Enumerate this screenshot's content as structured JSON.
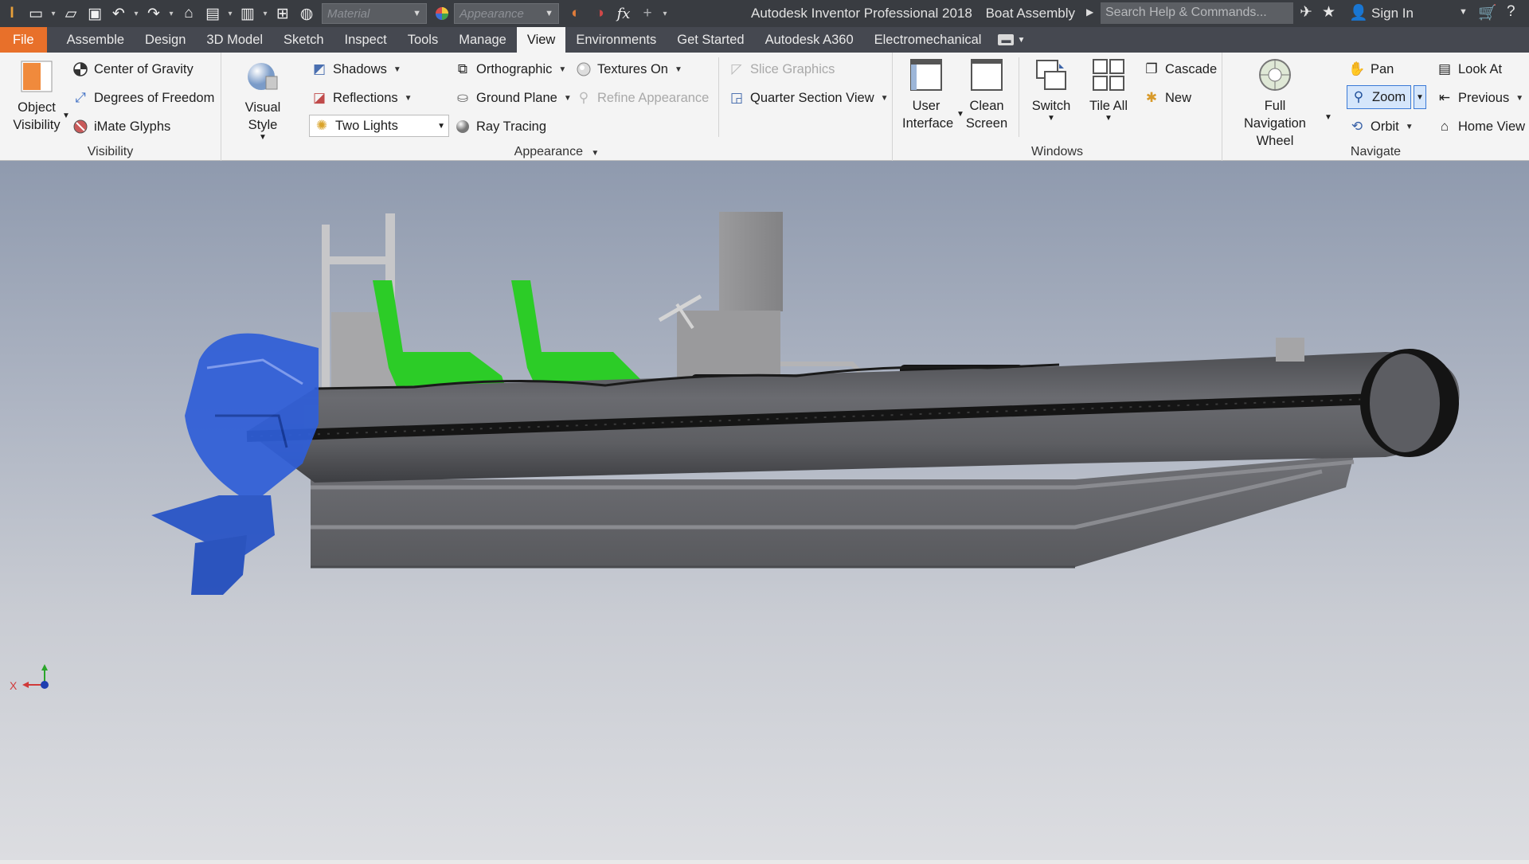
{
  "app_title": "Autodesk Inventor Professional 2018",
  "document_title": "Boat Assembly",
  "quick_access": {
    "material_placeholder": "Material",
    "appearance_placeholder": "Appearance",
    "fx_label": "fx"
  },
  "search": {
    "placeholder": "Search Help & Commands..."
  },
  "sign_in": "Sign In",
  "tabs": [
    "File",
    "Assemble",
    "Design",
    "3D Model",
    "Sketch",
    "Inspect",
    "Tools",
    "Manage",
    "View",
    "Environments",
    "Get Started",
    "Autodesk A360",
    "Electromechanical"
  ],
  "active_tab": "View",
  "panels": {
    "visibility": {
      "title": "Visibility",
      "object_visibility": "Object Visibility",
      "center_of_gravity": "Center of Gravity",
      "degrees_of_freedom": "Degrees of Freedom",
      "imate_glyphs": "iMate Glyphs"
    },
    "appearance": {
      "title": "Appearance",
      "visual_style": "Visual Style",
      "shadows": "Shadows",
      "reflections": "Reflections",
      "lighting_value": "Two Lights",
      "orthographic": "Orthographic",
      "ground_plane": "Ground Plane",
      "ray_tracing": "Ray Tracing",
      "textures_on": "Textures On",
      "refine_appearance": "Refine Appearance",
      "slice_graphics": "Slice Graphics",
      "quarter_section_view": "Quarter Section View"
    },
    "windows": {
      "title": "Windows",
      "user_interface": "User Interface",
      "clean_screen": "Clean Screen",
      "switch": "Switch",
      "tile_all": "Tile All",
      "cascade": "Cascade",
      "new": "New"
    },
    "navigate": {
      "title": "Navigate",
      "full_navigation_wheel": "Full Navigation Wheel",
      "pan": "Pan",
      "zoom": "Zoom",
      "orbit": "Orbit",
      "look_at": "Look At",
      "previous": "Previous",
      "home_view": "Home View"
    }
  },
  "viewport": {
    "axis_x_label": "X",
    "model_colors": {
      "tube": "#5a5b5f",
      "hull": "#6e6f73",
      "engine": "#2e5bd6",
      "seats": "#2ecb28",
      "frame": "#b9b9bb",
      "background_top": "#8f9aae",
      "background_bottom": "#dcdde1"
    }
  }
}
